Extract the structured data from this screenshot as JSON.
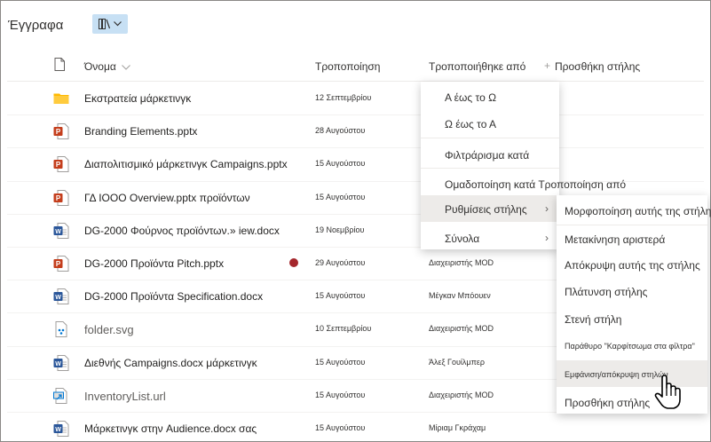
{
  "library": {
    "title": "Έγγραφα",
    "view_icon": "library-view-icon"
  },
  "columns": {
    "type_icon": "file-type-icon",
    "name": "Όνομα",
    "modified": "Τροποποίηση",
    "modified_by": "Τροποποιήθηκε από",
    "add_column": "Προσθήκη στήλης"
  },
  "rows": [
    {
      "type": "folder",
      "name": "Εκστρατεία μάρκετινγκ",
      "date": "12 Σεπτεμβρίου",
      "by": ""
    },
    {
      "type": "pptx",
      "name": "Branding Elements.pptx",
      "date": "28 Αυγούστου",
      "by": ""
    },
    {
      "type": "pptx",
      "name": "Διαπολιτισμικό μάρκετινγκ Campaigns.pptx",
      "date": "15 Αυγούστου",
      "by": ""
    },
    {
      "type": "pptx",
      "name": "ΓΔ ΙΟΟΟ Overview.pptx προϊόντων",
      "date": "15 Αυγούστου",
      "by": ""
    },
    {
      "type": "docx",
      "name": "DG-2000 Φούρνος προϊόντων.» iew.docx",
      "date": "19 Νοεμβρίου",
      "by": ""
    },
    {
      "type": "pptx",
      "name": "DG-2000 Προϊόντα Pitch.pptx",
      "date": "29 Αυγούστου",
      "by": "Διαχειριστής MOD",
      "flag": true
    },
    {
      "type": "docx",
      "name": "DG-2000 Προϊόντα Specification.docx",
      "date": "15 Αυγούστου",
      "by": "Μέγκαν Μπόουεν"
    },
    {
      "type": "svg",
      "name": "folder.svg",
      "date": "10 Σεπτεμβρίου",
      "by": "Διαχειριστής MOD"
    },
    {
      "type": "docx",
      "name": "Διεθνής Campaigns.docx μάρκετινγκ",
      "date": "15 Αυγούστου",
      "by": "Άλεξ Γουίλμπερ"
    },
    {
      "type": "url",
      "name": "InventoryList.url",
      "date": "15 Αυγούστου",
      "by": "Διαχειριστής MOD"
    },
    {
      "type": "docx",
      "name": "Μάρκετινγκ στην Audience.docx σας",
      "date": "15 Αυγούστου",
      "by": "Μίριαμ Γκράχαμ"
    }
  ],
  "column_menu": {
    "sort_az": "Α έως το Ω",
    "sort_za": "Ω έως το Α",
    "filter_by": "Φιλτράρισμα κατά",
    "group_by": "Ομαδοποίηση κατά Τροποποίηση από",
    "column_settings": "Ρυθμίσεις στήλης",
    "totals": "Σύνολα"
  },
  "settings_submenu": {
    "format": "Μορφοποίηση αυτής της στήλης",
    "move_left": "Μετακίνηση αριστερά",
    "hide": "Απόκρυψη αυτής της στήλης",
    "widen": "Πλάτυνση στήλης",
    "narrow": "Στενή στήλη",
    "pin_filters": "Παράθυρο \"Καρφίτσωμα στα φίλτρα\"",
    "show_hide": "Εμφάνιση/απόκρυψη στηλών",
    "add_column": "Προσθήκη στήλης"
  },
  "colors": {
    "accent": "#0078d4",
    "ppt": "#c43e1c",
    "word": "#2b579a",
    "folder": "#ffb900",
    "hover": "#edebe9"
  }
}
